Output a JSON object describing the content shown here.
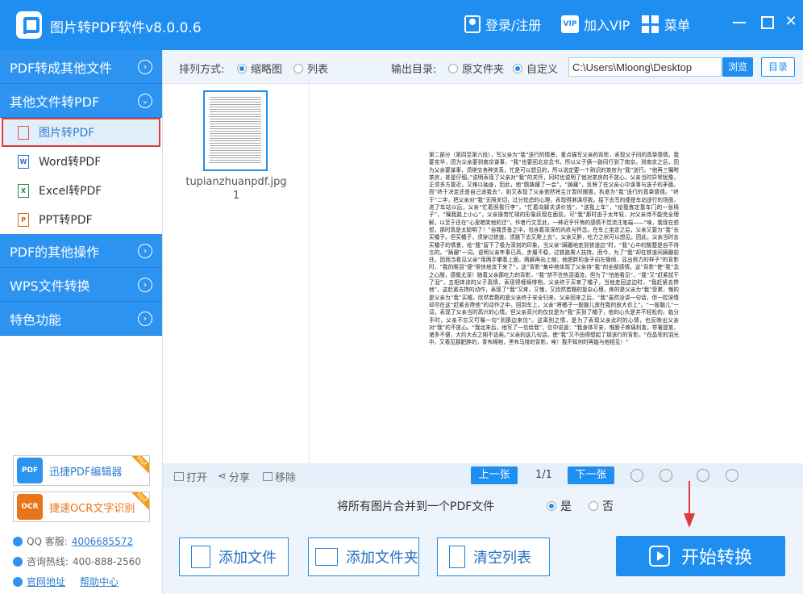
{
  "app": {
    "title": "图片转PDF软件v8.0.0.6"
  },
  "titlebar": {
    "login": "登录/注册",
    "vip": "加入VIP",
    "vip_badge": "VIP",
    "menu": "菜单",
    "close": "✕"
  },
  "sidebar": {
    "sections": [
      {
        "label": "PDF转成其他文件",
        "chevron": "›"
      },
      {
        "label": "其他文件转PDF",
        "chevron": "⌄"
      }
    ],
    "subitems": [
      {
        "label": "图片转PDF",
        "active": true,
        "icon": "image-file-icon",
        "glyph": ""
      },
      {
        "label": "Word转PDF",
        "icon": "word-file-icon",
        "glyph": "W"
      },
      {
        "label": "Excel转PDF",
        "icon": "excel-file-icon",
        "glyph": "X"
      },
      {
        "label": "PPT转PDF",
        "icon": "ppt-file-icon",
        "glyph": "P"
      }
    ],
    "more_sections": [
      {
        "label": "PDF的其他操作",
        "chevron": "›"
      },
      {
        "label": "WPS文件转换",
        "chevron": "›"
      },
      {
        "label": "特色功能",
        "chevron": "›"
      }
    ],
    "promos": [
      {
        "label": "迅捷PDF编辑器",
        "logo_text": "PDF",
        "hot": "Hot",
        "color": "#2d93f0"
      },
      {
        "label": "捷速OCR文字识别",
        "logo_text": "OCR",
        "hot": "Hot",
        "color": "#e8751a"
      }
    ],
    "contacts": {
      "qq_label": "QQ 客服:",
      "qq_number": "4006685572",
      "hotline_label": "咨询热线:",
      "hotline_number": "400-888-2560",
      "website": "官网地址",
      "help": "帮助中心"
    }
  },
  "toolbar": {
    "sort_label": "排列方式:",
    "sort_options": [
      "缩略图",
      "列表"
    ],
    "sort_selected": "缩略图",
    "output_label": "输出目录:",
    "output_options": [
      "原文件夹",
      "自定义"
    ],
    "output_selected": "自定义",
    "path_value": "C:\\Users\\Mloong\\Desktop",
    "browse": "浏览",
    "directory": "目录"
  },
  "file_list": [
    {
      "name": "tupianzhuanpdf.jpg",
      "index": "1"
    }
  ],
  "preview": {
    "page_text": "第二部分（第四至第六段），写父亲为“我”送行的情景，重点描写父亲的背影，表现父子间的真挚感情。我要克华，因为父亲要到南京谋事，“我”也要回北京念书，所以父子俩一路同行到了南京。到南京之后，因为父亲要谋事，须继交各种关系，忙是可以想见的，所以说定要一个熟识的茶房为“我”送行。“他再三嘱咐茶房，甚是仔细。”说明表现了父亲对“我”的关怀，同时也说明了他对茶房的不放心。父亲当时异常犹豫，正须多方靠近，又难以抽身，因此，他“颇踌躇了一会”。“踌躇”，反映了在父亲心中谋事与送子的矛盾。而“终于决定还是自己送我去”，则又表现了父亲割然将主计暂时搁置，执意为“我”送行的真挚感情。“终于”二字，把父亲对“我”无限关切，过分忧虑的心理，表现得淋漓尽致。接下去写的便是车站送行的场面，进了车站以后，父亲“忙着照看行李”，“忙着向脚夫讲价钱”，“送我上车”，“给我拣定靠车门的一张椅子”，“嘱我路上小心”，父亲操劳忙碌的形象跃现在面前。可“我”那时由于太年轻，对父亲待不能完全理解，以至于还在“心里暗笑他的迂”。作者行文至此，一种近乎忏悔的感情不觉流注笔端——“唉，我现在想想，那时真是太聪明了！”自我责备之中，包含着深深的内疚与怀念。在车上坐定之后，父亲又要为“我”去买橘子。但买橘子，须穿过铁道，须跳下去又爬上去”。父亲又胖，吃力之状可以想见。因此，父亲当时去买橘子的情景，给“我”留下了极为深刻的印象。当父亲“蹒跚地走到铁道边”时，“我”心中的酸楚是自不待言的。“蹒跚”一词，说明父亲年事已高，步履不稳，过铁路需人扶持。而今，为了“我”却在铁道间蹒跚前往。因而当看见父亲“用两手攀着上面，两脚再向上缩；他肥胖的身子向左微倾，显出努力的样子”的背影时，“我的眼泪”便“很快地流下来了”。这“背影”集中地体现了父亲待“我”的全部感情，这“背影”使“我”念之心酸，感慨尤深！随着父亲那吃力的背影，“我”禁不住热泪涌流，但为了“怕他看见”，“我”又“赶紧拭干了泪”，五相体谅的父子真情，表现得缠绵悱恻。父亲终于买来了橘子，当他走回这边时，“我赶紧去搀他”。这赶紧去搀的动作，表现了“我”又疼，又愧，又欣然若鞘的复杂心理。疼的是父亲为“我”受累，愧的是父亲为“我”买橘，欣然若鞘的是父亲终于安全归来。父亲回来之后，“我”虽然没讲一句话，但一腔深情却尽在这“赶紧去搀他”的动作之中。回到车上，父亲“将橘子一股脑儿放在我的皮大衣上”。“一股脑儿”一词，表现了父亲当时高兴的心情。但父亲高兴的仅仅是为“我”买到了橘子，他的心头是并不轻松的。临分手时，父亲不忘又叮嘱一句“到那边来信”。这离别之情，是为了表现父亲此时的心情，也反映出父亲对“我”的不放心。“我北来后，他写了一信给我”，信中说道：“我身体平安，惟膀子疼痛利害，举箸提笔，诸多不便，大约大去之期不远矣。”父亲的这几句话，使“我”又不由得想起了那送行的背影。“在晶莹的泪光中，又看见那肥胖的，青布棉袍，黑布马褂的背影。唉！我不知何时再能与他相见！”",
    "page_number": "1/1"
  },
  "bottom_tools": {
    "open": "打开",
    "share": "分享",
    "remove": "移除",
    "prev": "上一张",
    "next": "下一张",
    "page_counter": "1/1"
  },
  "merge": {
    "label": "将所有图片合并到一个PDF文件",
    "yes": "是",
    "no": "否",
    "selected": "是"
  },
  "actions": {
    "add_file": "添加文件",
    "add_folder": "添加文件夹",
    "clear_list": "清空列表",
    "start": "开始转换"
  }
}
